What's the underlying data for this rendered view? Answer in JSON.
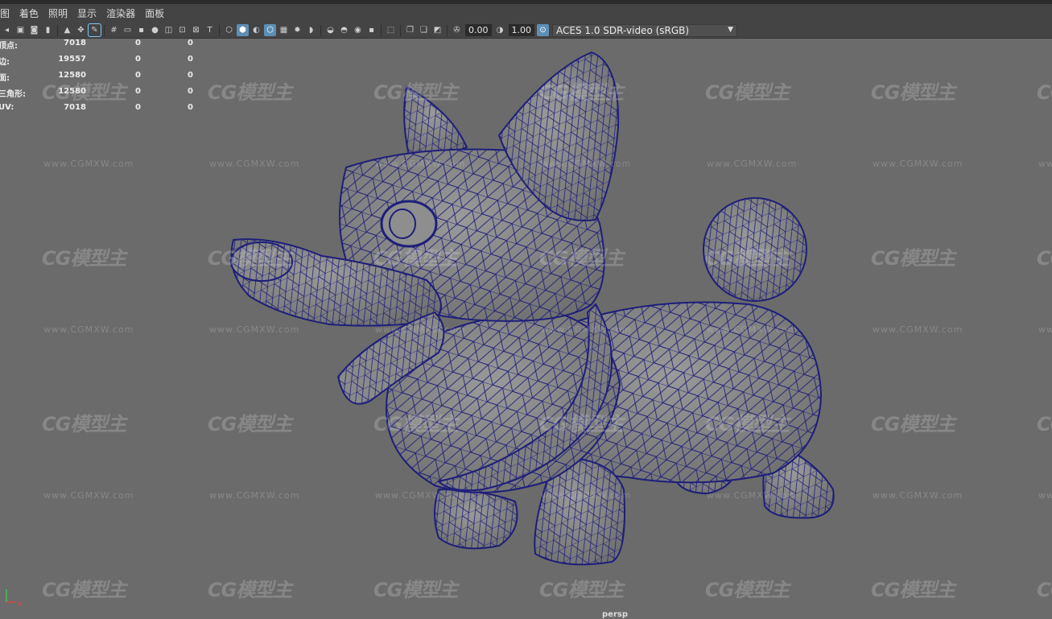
{
  "menubar": {
    "items": [
      "图",
      "着色",
      "照明",
      "显示",
      "渲染器",
      "面板"
    ]
  },
  "toolbar": {
    "exposure": "0.00",
    "gamma": "1.00",
    "colorspace": "ACES 1.0 SDR-video (sRGB)"
  },
  "hud": {
    "rows": [
      {
        "label": "顶点:",
        "v1": "7018",
        "v2": "0",
        "v3": "0"
      },
      {
        "label": "边:",
        "v1": "19557",
        "v2": "0",
        "v3": "0"
      },
      {
        "label": "面:",
        "v1": "12580",
        "v2": "0",
        "v3": "0"
      },
      {
        "label": "三角形:",
        "v1": "12580",
        "v2": "0",
        "v3": "0"
      },
      {
        "label": "UV:",
        "v1": "7018",
        "v2": "0",
        "v3": "0"
      }
    ]
  },
  "viewport": {
    "camera": "persp",
    "background_color": "#6b6b6b",
    "wireframe_color": "#1e1e7a",
    "mesh_color": "#8a8a8a"
  },
  "watermark": {
    "logo": "CG模型主",
    "url": "www.CGMXW.com"
  },
  "icons": [
    "select-icon",
    "lasso-icon",
    "paint-icon",
    "grid-icon",
    "film-gate-icon",
    "resolution-gate-icon",
    "safe-action-icon",
    "hud-icon",
    "wireframe-icon",
    "smooth-shade-icon",
    "textured-icon",
    "lights-icon",
    "shadows-icon",
    "ao-icon",
    "isolate-icon",
    "xray-icon",
    "exposure-icon",
    "gamma-icon",
    "colorspace-icon"
  ]
}
